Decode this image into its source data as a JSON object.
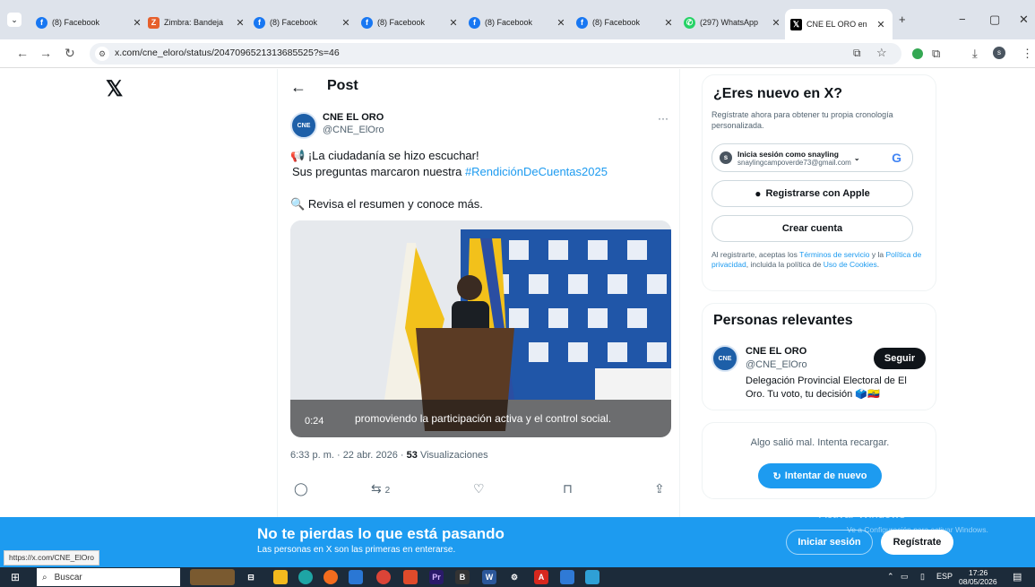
{
  "browser": {
    "tabs": [
      {
        "title": "(8) Facebook",
        "icon": "facebook-icon"
      },
      {
        "title": "Zimbra: Bandeja",
        "icon": "zimbra-icon"
      },
      {
        "title": "(8) Facebook",
        "icon": "facebook-icon"
      },
      {
        "title": "(8) Facebook",
        "icon": "facebook-icon"
      },
      {
        "title": "(8) Facebook",
        "icon": "facebook-icon"
      },
      {
        "title": "(8) Facebook",
        "icon": "facebook-icon"
      },
      {
        "title": "(297) WhatsApp",
        "icon": "whatsapp-icon"
      },
      {
        "title": "CNE EL ORO en",
        "icon": "x-icon",
        "active": true
      }
    ],
    "url": "x.com/cne_eloro/status/2047096521313685525?s=46",
    "hover_url": "https://x.com/CNE_ElOro",
    "profile_initial": "s"
  },
  "post": {
    "header_title": "Post",
    "author_name": "CNE EL ORO",
    "author_handle": "@CNE_ElOro",
    "avatar_text": "CNE",
    "line1": "¡La ciudadanía se hizo escuchar!",
    "line2_prefix": "Sus preguntas marcaron nuestra ",
    "hashtag": "#RendiciónDeCuentas2025",
    "line3": "Revisa el resumen y conoce más.",
    "video_time": "0:24",
    "video_caption": "promoviendo la participación activa y el control social.",
    "timestamp": "6:33 p. m. · 22 abr. 2026 · ",
    "views_count": "53",
    "views_label": " Visualizaciones",
    "retweet_count": "2",
    "more_label": "···"
  },
  "signup": {
    "title": "¿Eres nuevo en X?",
    "subtitle": "Regístrate ahora para obtener tu propia cronología personalizada.",
    "google_label": "Inicia sesión como snayling",
    "google_email": "snaylingcampoverde73@gmail.com",
    "google_initial": "s",
    "apple_label": "Registrarse con Apple",
    "create_label": "Crear cuenta",
    "legal_prefix": "Al registrarte, aceptas los ",
    "legal_terms": "Términos de servicio",
    "legal_mid": " y la ",
    "legal_privacy": "Política de privacidad",
    "legal_mid2": ", incluida la política de ",
    "legal_cookies": "Uso de Cookies",
    "legal_end": "."
  },
  "relevant": {
    "title": "Personas relevantes",
    "name": "CNE EL ORO",
    "handle": "@CNE_ElOro",
    "bio": "Delegación Provincial Electoral de El Oro. Tu voto, tu decisión 🗳️🇪🇨",
    "follow_label": "Seguir"
  },
  "error_card": {
    "message": "Algo salió mal. Intenta recargar.",
    "retry_label": "Intentar de nuevo"
  },
  "banner": {
    "title": "No te pierdas lo que está pasando",
    "subtitle": "Las personas en X son las primeras en enterarse.",
    "login_label": "Iniciar sesión",
    "register_label": "Regístrate"
  },
  "watermark": {
    "title": "Activar Windows",
    "subtitle": "Ve a Configuración para activar Windows."
  },
  "taskbar": {
    "search_placeholder": "Buscar",
    "lang": "ESP",
    "time": "17:26",
    "date": "08/05/2026"
  },
  "colors": {
    "accent": "#1d9bf0",
    "facebook": "#1877f2",
    "whatsapp": "#25d366"
  }
}
